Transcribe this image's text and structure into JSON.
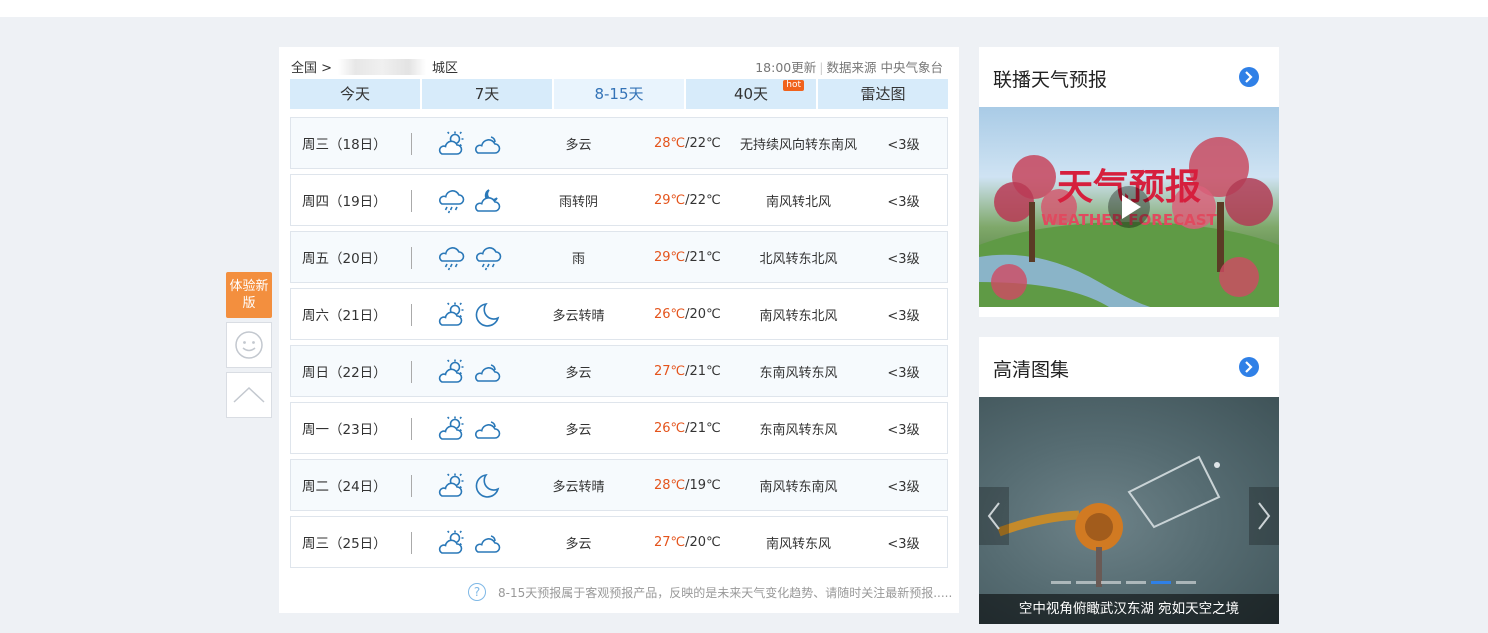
{
  "side": {
    "try_new": "体验新版"
  },
  "breadcrumb": {
    "root": "全国 >",
    "district": "城区"
  },
  "update": {
    "time": "18:00更新",
    "source_label": "数据来源",
    "source": "中央气象台"
  },
  "tabs": [
    {
      "label": "今天",
      "active": false,
      "hot": false
    },
    {
      "label": "7天",
      "active": false,
      "hot": false
    },
    {
      "label": "8-15天",
      "active": true,
      "hot": false
    },
    {
      "label": "40天",
      "active": false,
      "hot": true
    },
    {
      "label": "雷达图",
      "active": false,
      "hot": false
    }
  ],
  "hot_badge": "hot",
  "forecast": [
    {
      "date": "周三（18日）",
      "icon_day": "partly-cloudy-day-icon",
      "icon_night": "cloudy-icon",
      "desc": "多云",
      "high": "28℃",
      "low": "/22℃",
      "wind": "无持续风向转东南风",
      "level": "<3级"
    },
    {
      "date": "周四（19日）",
      "icon_day": "rain-icon",
      "icon_night": "cloudy-night-icon",
      "desc": "雨转阴",
      "high": "29℃",
      "low": "/22℃",
      "wind": "南风转北风",
      "level": "<3级"
    },
    {
      "date": "周五（20日）",
      "icon_day": "rain-icon",
      "icon_night": "rain-icon",
      "desc": "雨",
      "high": "29℃",
      "low": "/21℃",
      "wind": "北风转东北风",
      "level": "<3级"
    },
    {
      "date": "周六（21日）",
      "icon_day": "partly-cloudy-day-icon",
      "icon_night": "moon-icon",
      "desc": "多云转晴",
      "high": "26℃",
      "low": "/20℃",
      "wind": "南风转东北风",
      "level": "<3级"
    },
    {
      "date": "周日（22日）",
      "icon_day": "partly-cloudy-day-icon",
      "icon_night": "cloudy-icon",
      "desc": "多云",
      "high": "27℃",
      "low": "/21℃",
      "wind": "东南风转东风",
      "level": "<3级"
    },
    {
      "date": "周一（23日）",
      "icon_day": "partly-cloudy-day-icon",
      "icon_night": "cloudy-icon",
      "desc": "多云",
      "high": "26℃",
      "low": "/21℃",
      "wind": "东南风转东风",
      "level": "<3级"
    },
    {
      "date": "周二（24日）",
      "icon_day": "partly-cloudy-day-icon",
      "icon_night": "moon-icon",
      "desc": "多云转晴",
      "high": "28℃",
      "low": "/19℃",
      "wind": "南风转东南风",
      "level": "<3级"
    },
    {
      "date": "周三（25日）",
      "icon_day": "partly-cloudy-day-icon",
      "icon_night": "cloudy-icon",
      "desc": "多云",
      "high": "27℃",
      "low": "/20℃",
      "wind": "南风转东风",
      "level": "<3级"
    }
  ],
  "note": "8-15天预报属于客观预报产品，反映的是未来天气变化趋势、请随时关注最新预报.....",
  "video_card": {
    "title": "联播天气预报",
    "banner_title": "天气预报",
    "banner_sub": "WEATHER FORECAST"
  },
  "gallery_card": {
    "title": "高清图集",
    "caption": "空中视角俯瞰武汉东湖 宛如天空之境",
    "slide_count": 6,
    "active_slide": 5
  },
  "colors": {
    "accent_blue": "#2f80e7",
    "temp_high": "#e4541c",
    "icon_blue": "#2a78b8",
    "try_new_bg": "#f38f3e"
  }
}
